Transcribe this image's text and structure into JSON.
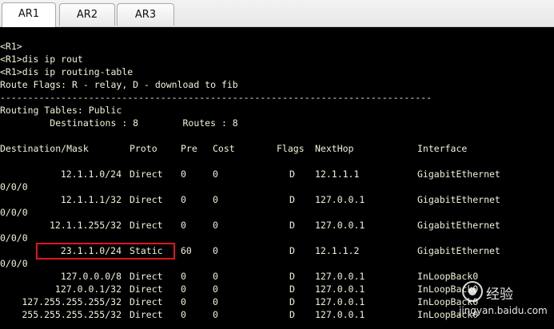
{
  "tabs": [
    {
      "label": "AR1",
      "active": true
    },
    {
      "label": "AR2",
      "active": false
    },
    {
      "label": "AR3",
      "active": false
    }
  ],
  "console": {
    "prompt_lines": [
      "<R1>",
      "<R1>dis ip rout",
      "<R1>dis ip routing-table",
      "Route Flags: R - relay, D - download to fib"
    ],
    "separator": "------------------------------------------------------------------------------",
    "tables_label": "Routing Tables: Public",
    "summary": "         Destinations : 8        Routes : 8",
    "headers": {
      "dest": "Destination/Mask",
      "proto": "Proto",
      "pre": "Pre",
      "cost": "Cost",
      "flags": "Flags",
      "nexthop": "NextHop",
      "interface": "Interface"
    },
    "routes": [
      {
        "dest": "12.1.1.0/24",
        "proto": "Direct",
        "pre": "0",
        "cost": "0",
        "flags": "D",
        "nexthop": "12.1.1.1",
        "interface": "GigabitEthernet",
        "wrap": "0/0/0"
      },
      {
        "dest": "12.1.1.1/32",
        "proto": "Direct",
        "pre": "0",
        "cost": "0",
        "flags": "D",
        "nexthop": "127.0.0.1",
        "interface": "GigabitEthernet",
        "wrap": "0/0/0"
      },
      {
        "dest": "12.1.1.255/32",
        "proto": "Direct",
        "pre": "0",
        "cost": "0",
        "flags": "D",
        "nexthop": "127.0.0.1",
        "interface": "GigabitEthernet",
        "wrap": "0/0/0"
      },
      {
        "dest": "23.1.1.0/24",
        "proto": "Static",
        "pre": "60",
        "cost": "0",
        "flags": "D",
        "nexthop": "12.1.1.2",
        "interface": "GigabitEthernet",
        "wrap": "0/0/0"
      },
      {
        "dest": "127.0.0.0/8",
        "proto": "Direct",
        "pre": "0",
        "cost": "0",
        "flags": "D",
        "nexthop": "127.0.0.1",
        "interface": "InLoopBack0"
      },
      {
        "dest": "127.0.0.1/32",
        "proto": "Direct",
        "pre": "0",
        "cost": "0",
        "flags": "D",
        "nexthop": "127.0.0.1",
        "interface": "InLoopBack0"
      },
      {
        "dest": "127.255.255.255/32",
        "proto": "Direct",
        "pre": "0",
        "cost": "0",
        "flags": "D",
        "nexthop": "127.0.0.1",
        "interface": "InLoopBack0"
      },
      {
        "dest": "255.255.255.255/32",
        "proto": "Direct",
        "pre": "0",
        "cost": "0",
        "flags": "D",
        "nexthop": "127.0.0.1",
        "interface": "InLoopBack0"
      }
    ]
  },
  "watermark": {
    "brand": "经验",
    "sub": "jingyan.baidu.com"
  },
  "colors": {
    "console_bg": "#000000",
    "console_text": "#f2f2d8",
    "highlight": "#e0141e"
  }
}
